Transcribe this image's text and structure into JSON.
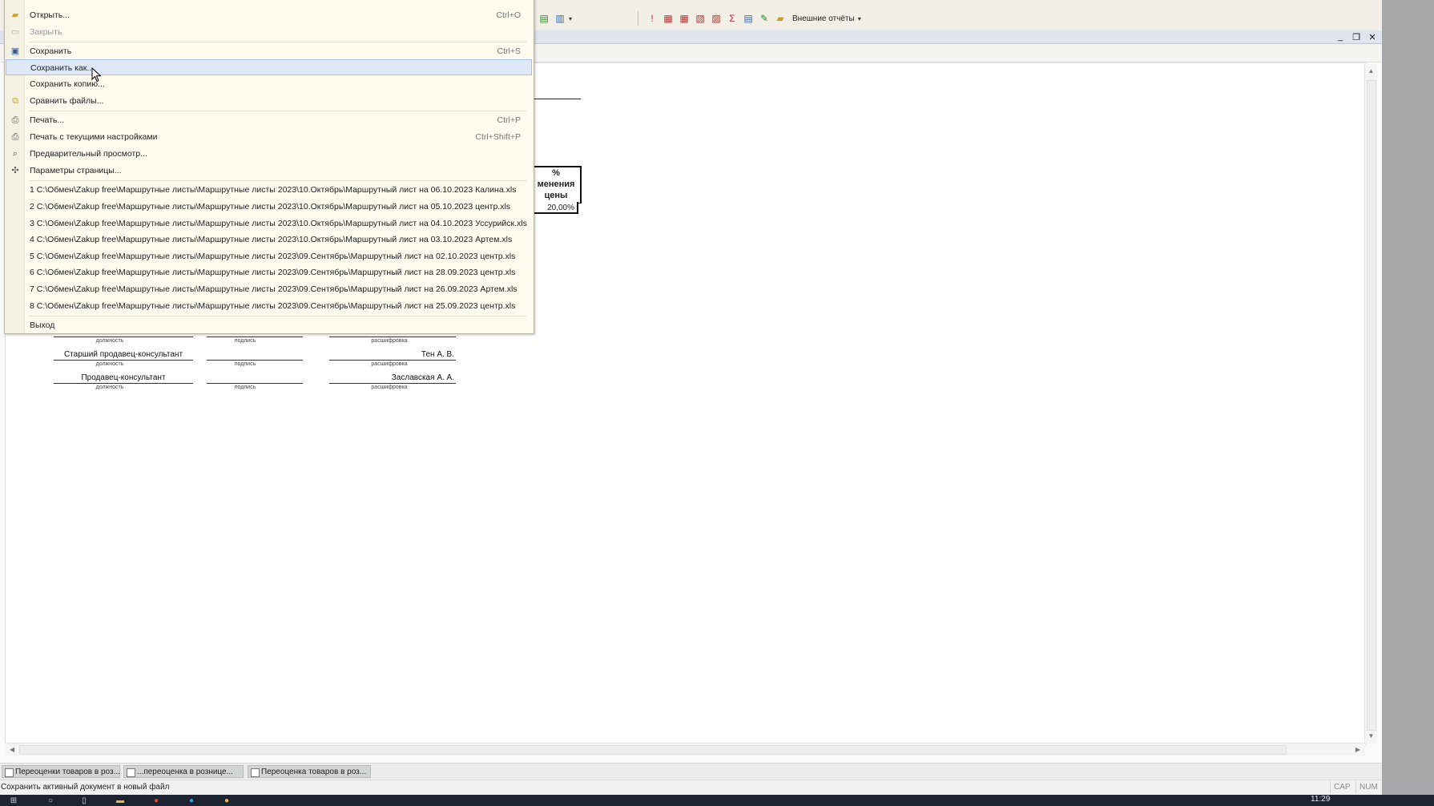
{
  "toolbar": {
    "external_reports": "Внешние отчёты"
  },
  "sheet": {
    "pct_header": [
      "%",
      "менения",
      "цены"
    ],
    "pct_value": "20,00%",
    "signatures": [
      {
        "position": "",
        "position_cap": "должность",
        "sign_cap": "подпись",
        "name": "",
        "name_cap": "расшифровка"
      },
      {
        "position": "Старший продавец-консультант",
        "position_cap": "должность",
        "sign_cap": "подпись",
        "name": "Тен А. В.",
        "name_cap": "расшифровка"
      },
      {
        "position": "Продавец-консультант",
        "position_cap": "должность",
        "sign_cap": "подпись",
        "name": "Заславская А. А.",
        "name_cap": "расшифровка"
      }
    ]
  },
  "file_menu": {
    "items": [
      {
        "label": "Открыть...",
        "shortcut": "Ctrl+O",
        "icon": "folder-open-icon",
        "disabled": false
      },
      {
        "label": "Закрыть",
        "shortcut": "",
        "icon": "close-doc-icon",
        "disabled": true
      },
      {
        "label": "Сохранить",
        "shortcut": "Ctrl+S",
        "icon": "save-icon",
        "disabled": false
      },
      {
        "label": "Сохранить как...",
        "shortcut": "",
        "icon": "",
        "disabled": false,
        "highlighted": true
      },
      {
        "label": "Сохранить копию...",
        "shortcut": "",
        "icon": "",
        "disabled": false
      },
      {
        "label": "Сравнить файлы...",
        "shortcut": "",
        "icon": "compare-icon",
        "disabled": false
      },
      {
        "label": "Печать...",
        "shortcut": "Ctrl+P",
        "icon": "print-icon",
        "disabled": false
      },
      {
        "label": "Печать с текущими настройками",
        "shortcut": "Ctrl+Shift+P",
        "icon": "print-settings-icon",
        "disabled": false
      },
      {
        "label": "Предварительный просмотр...",
        "shortcut": "",
        "icon": "preview-icon",
        "disabled": false
      },
      {
        "label": "Параметры страницы...",
        "shortcut": "",
        "icon": "page-setup-icon",
        "disabled": false
      }
    ],
    "recent_files": [
      "1 С:\\Обмен\\Zakup free\\Маршрутные листы\\Маршрутные листы 2023\\10.Октябрь\\Маршрутный лист на 06.10.2023 Калина.xls",
      "2 С:\\Обмен\\Zakup free\\Маршрутные листы\\Маршрутные листы 2023\\10.Октябрь\\Маршрутный лист на 05.10.2023 центр.xls",
      "3 С:\\Обмен\\Zakup free\\Маршрутные листы\\Маршрутные листы 2023\\10.Октябрь\\Маршрутный лист на 04.10.2023 Уссурийск.xls",
      "4 С:\\Обмен\\Zakup free\\Маршрутные листы\\Маршрутные листы 2023\\10.Октябрь\\Маршрутный лист на 03.10.2023 Артем.xls",
      "5 С:\\Обмен\\Zakup free\\Маршрутные листы\\Маршрутные листы 2023\\09.Сентябрь\\Маршрутный лист на 02.10.2023 центр.xls",
      "6 С:\\Обмен\\Zakup free\\Маршрутные листы\\Маршрутные листы 2023\\09.Сентябрь\\Маршрутный лист на 28.09.2023 центр.xls",
      "7 С:\\Обмен\\Zakup free\\Маршрутные листы\\Маршрутные листы 2023\\09.Сентябрь\\Маршрутный лист на 26.09.2023 Артем.xls",
      "8 С:\\Обмен\\Zakup free\\Маршрутные листы\\Маршрутные листы 2023\\09.Сентябрь\\Маршрутный лист на 25.09.2023 центр.xls"
    ],
    "exit_label": "Выход"
  },
  "doc_tabs": [
    "Переоценки товаров в роз...",
    "...переоценка в рознице...",
    "Переоценка товаров в роз..."
  ],
  "status": {
    "text": "Сохранить активный документ в новый файл",
    "cap": "CAP",
    "num": "NUM"
  },
  "taskbar": {
    "clock": "11:29"
  }
}
